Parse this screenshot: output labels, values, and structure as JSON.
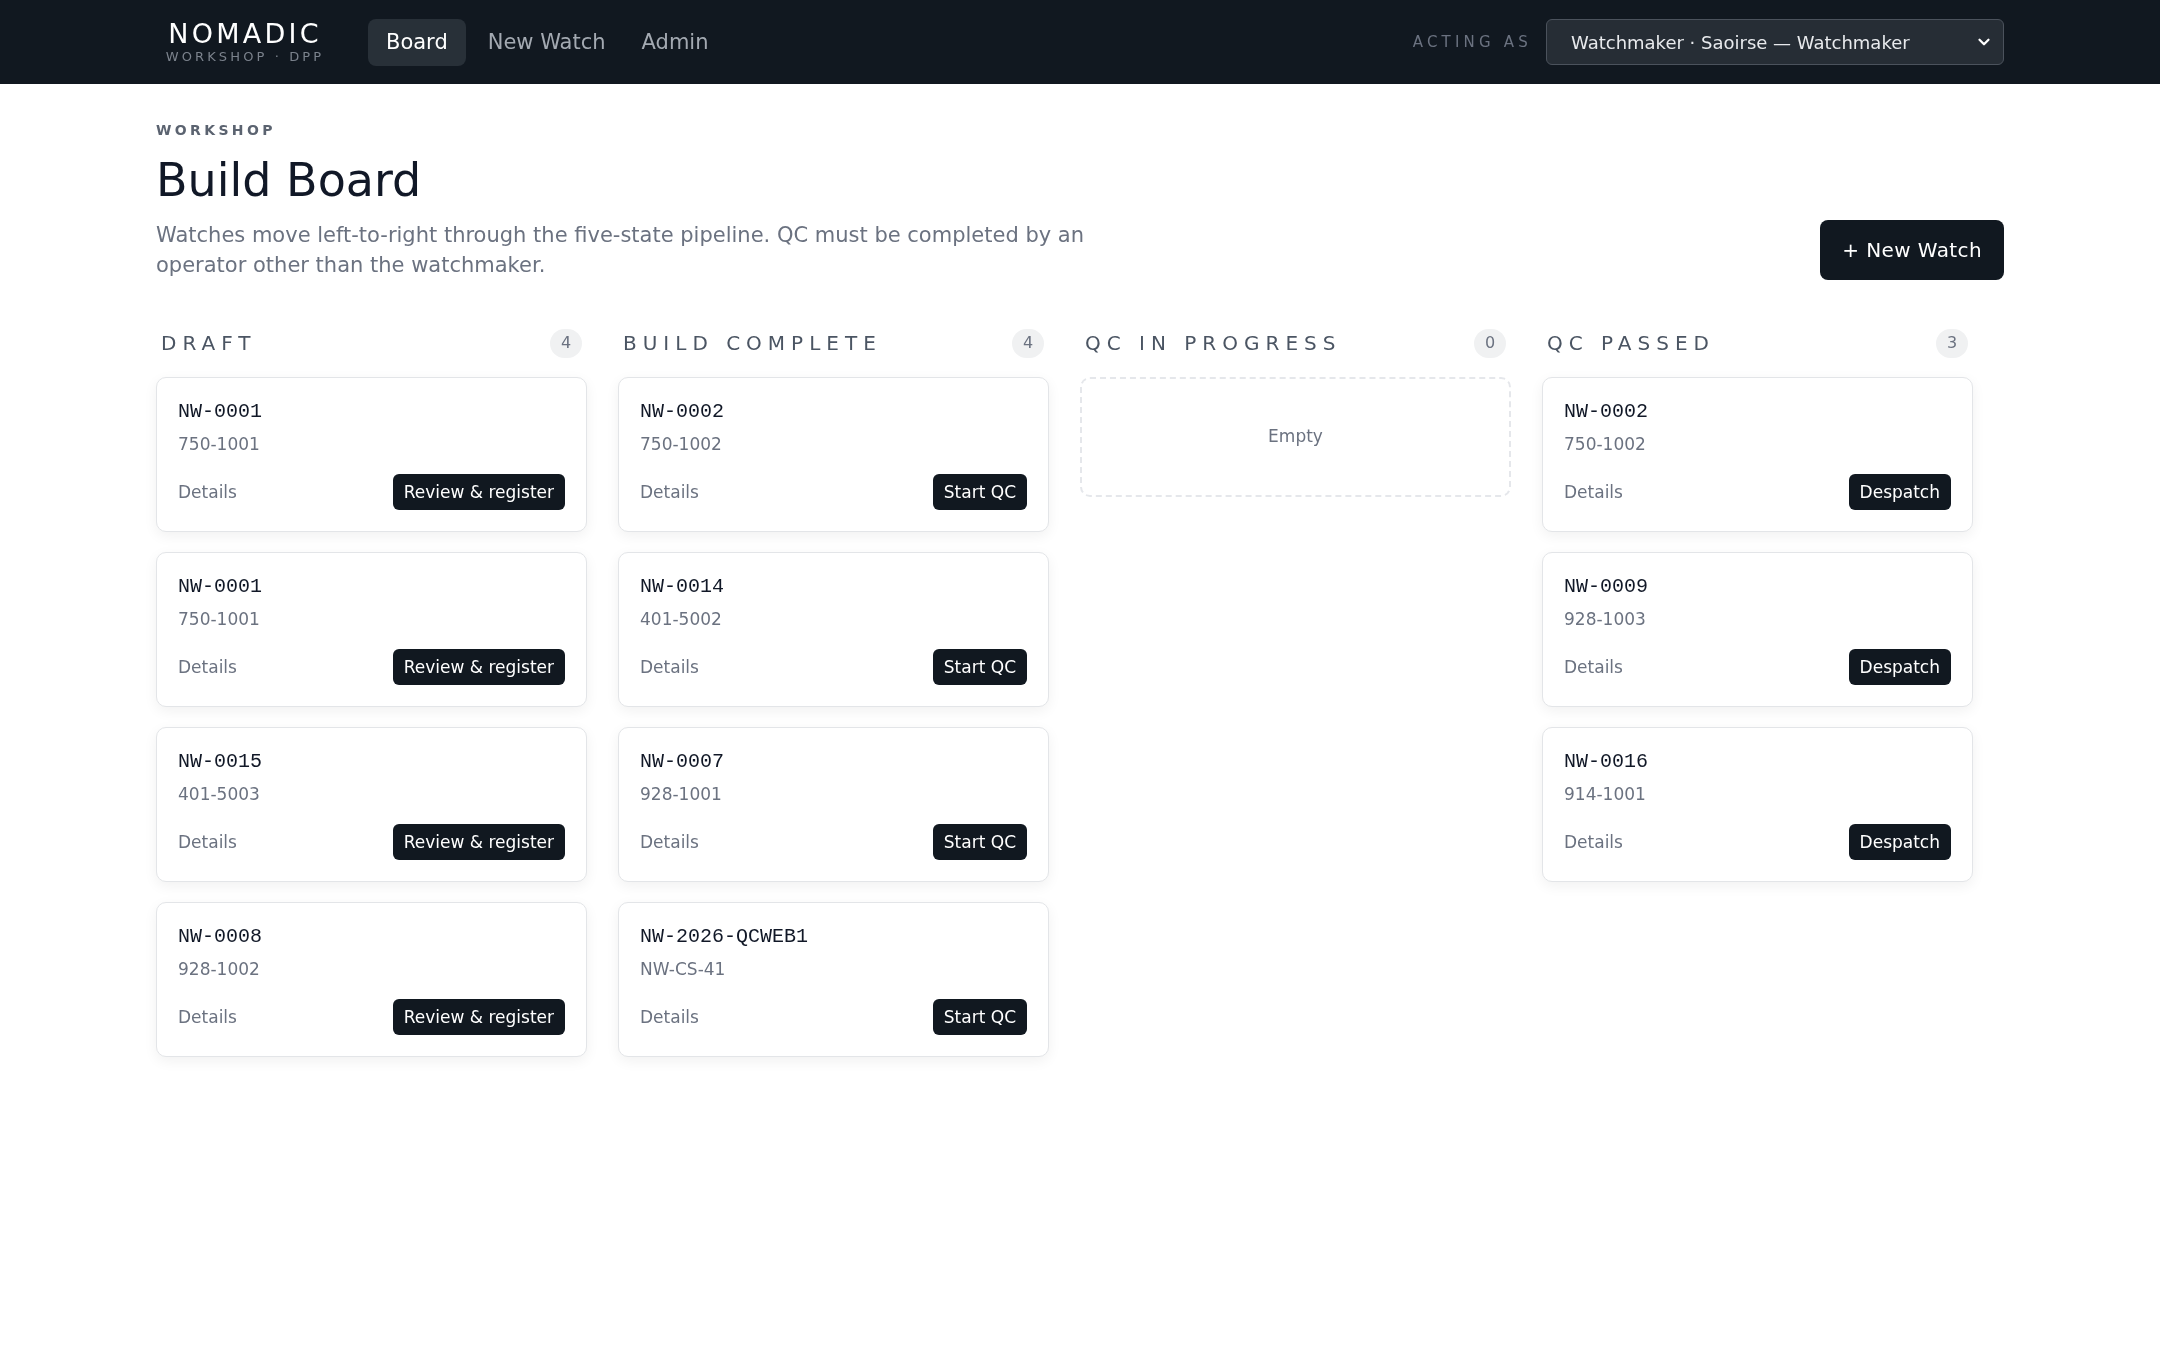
{
  "brand": {
    "name": "NOMADIC",
    "subtitle": "WORKSHOP · DPP"
  },
  "nav": [
    {
      "label": "Board",
      "selected": true
    },
    {
      "label": "New Watch",
      "selected": false
    },
    {
      "label": "Admin",
      "selected": false
    }
  ],
  "acting_as": {
    "label": "ACTING AS",
    "value": "Watchmaker · Saoirse — Watchmaker"
  },
  "page": {
    "eyebrow": "WORKSHOP",
    "title": "Build Board",
    "description": "Watches move left-to-right through the five-state pipeline. QC must be completed by an operator other than the watchmaker.",
    "primary_button": "+ New Watch"
  },
  "columns": [
    {
      "title": "DRAFT",
      "count": "4",
      "cards": [
        {
          "id": "NW-0001",
          "part": "750-1001",
          "link": "Details",
          "action": "Review & register"
        },
        {
          "id": "NW-0001",
          "part": "750-1001",
          "link": "Details",
          "action": "Review & register"
        },
        {
          "id": "NW-0015",
          "part": "401-5003",
          "link": "Details",
          "action": "Review & register"
        },
        {
          "id": "NW-0008",
          "part": "928-1002",
          "link": "Details",
          "action": "Review & register"
        }
      ]
    },
    {
      "title": "BUILD COMPLETE",
      "count": "4",
      "cards": [
        {
          "id": "NW-0002",
          "part": "750-1002",
          "link": "Details",
          "action": "Start QC"
        },
        {
          "id": "NW-0014",
          "part": "401-5002",
          "link": "Details",
          "action": "Start QC"
        },
        {
          "id": "NW-0007",
          "part": "928-1001",
          "link": "Details",
          "action": "Start QC"
        },
        {
          "id": "NW-2026-QCWEB1",
          "part": "NW-CS-41",
          "link": "Details",
          "action": "Start QC"
        }
      ]
    },
    {
      "title": "QC IN PROGRESS",
      "count": "0",
      "empty_label": "Empty"
    },
    {
      "title": "QC PASSED",
      "count": "3",
      "cards": [
        {
          "id": "NW-0002",
          "part": "750-1002",
          "link": "Details",
          "action": "Despatch"
        },
        {
          "id": "NW-0009",
          "part": "928-1003",
          "link": "Details",
          "action": "Despatch"
        },
        {
          "id": "NW-0016",
          "part": "914-1001",
          "link": "Details",
          "action": "Despatch"
        }
      ]
    }
  ]
}
